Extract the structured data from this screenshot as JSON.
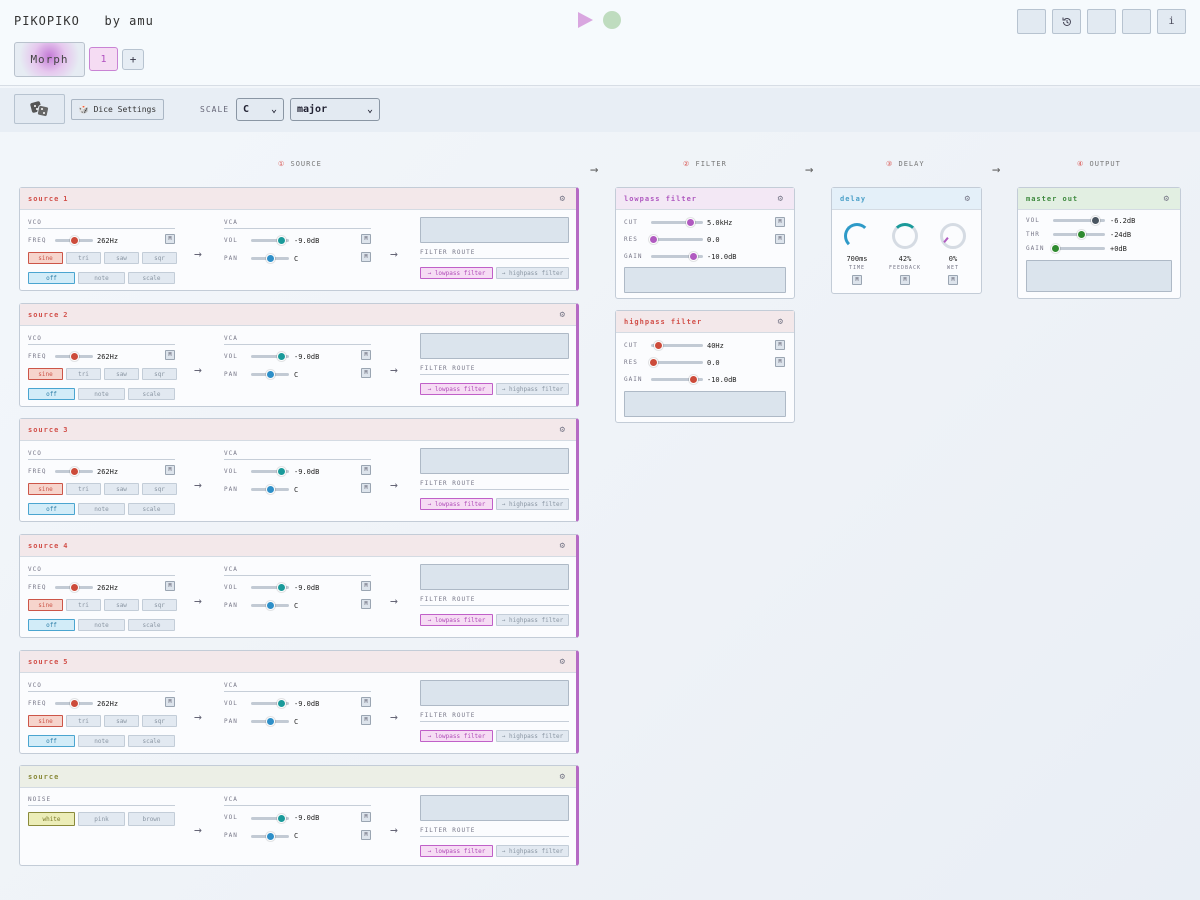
{
  "app": {
    "title": "PIKOPIKO",
    "byline": "by amu"
  },
  "toolbar": {
    "info_label": "i"
  },
  "morph": {
    "label": "Morph",
    "slots": [
      "1"
    ],
    "add_label": "+"
  },
  "dice": {
    "settings_label": "🎲 Dice Settings"
  },
  "scale": {
    "label": "SCALE",
    "key": "C",
    "mode": "major"
  },
  "sections": [
    {
      "num": "①",
      "name": "SOURCE"
    },
    {
      "num": "②",
      "name": "FILTER"
    },
    {
      "num": "③",
      "name": "DELAY"
    },
    {
      "num": "④",
      "name": "OUTPUT"
    }
  ],
  "arrows": {
    "right": "→"
  },
  "common": {
    "m_label": "M",
    "vco": "VCO",
    "vca": "VCA",
    "noise": "NOISE",
    "freq": "FREQ",
    "vol": "VOL",
    "pan": "PAN",
    "filter_route": "FILTER ROUTE",
    "gear": "⚙"
  },
  "waveforms": [
    "sine",
    "tri",
    "saw",
    "sqr"
  ],
  "quantize": [
    "off",
    "note",
    "scale"
  ],
  "noise_types": [
    "white",
    "pink",
    "brown"
  ],
  "routes": {
    "lowpass": "→ lowpass filter",
    "highpass": "→ highpass filter"
  },
  "sources": [
    {
      "name": "source",
      "num": "1",
      "freq": "262Hz",
      "vol": "-9.0dB",
      "pan": "C"
    },
    {
      "name": "source",
      "num": "2",
      "freq": "262Hz",
      "vol": "-9.0dB",
      "pan": "C"
    },
    {
      "name": "source",
      "num": "3",
      "freq": "262Hz",
      "vol": "-9.0dB",
      "pan": "C"
    },
    {
      "name": "source",
      "num": "4",
      "freq": "262Hz",
      "vol": "-9.0dB",
      "pan": "C"
    },
    {
      "name": "source",
      "num": "5",
      "freq": "262Hz",
      "vol": "-9.0dB",
      "pan": "C"
    }
  ],
  "noise_source": {
    "name": "source",
    "vol": "-9.0dB",
    "pan": "C"
  },
  "lowpass": {
    "title": "lowpass filter",
    "params": [
      {
        "label": "CUT",
        "value": "5.0kHz",
        "pos": 0.75
      },
      {
        "label": "RES",
        "value": "0.0",
        "pos": 0.05
      },
      {
        "label": "GAIN",
        "value": "-10.0dB",
        "pos": 0.82
      }
    ]
  },
  "highpass": {
    "title": "highpass filter",
    "params": [
      {
        "label": "CUT",
        "value": "40Hz",
        "pos": 0.15
      },
      {
        "label": "RES",
        "value": "0.0",
        "pos": 0.05
      },
      {
        "label": "GAIN",
        "value": "-10.0dB",
        "pos": 0.82
      }
    ]
  },
  "delay": {
    "title": "delay",
    "knobs": [
      {
        "value": "700ms",
        "label": "TIME"
      },
      {
        "value": "42%",
        "label": "FEEDBACK"
      },
      {
        "value": "0%",
        "label": "WET"
      }
    ]
  },
  "master": {
    "title": "master out",
    "params": [
      {
        "label": "VOL",
        "value": "-6.2dB",
        "pos": 0.82
      },
      {
        "label": "THR",
        "value": "-24dB",
        "pos": 0.55
      },
      {
        "label": "GAIN",
        "value": "+0dB",
        "pos": 0.05
      }
    ]
  },
  "colors": {
    "accent_purple": "#b56ac4",
    "source_red": "#d2504a",
    "vca_teal": "#1a9a9a",
    "pan_blue": "#2e8fc8",
    "master_green": "#2f8a2f"
  }
}
